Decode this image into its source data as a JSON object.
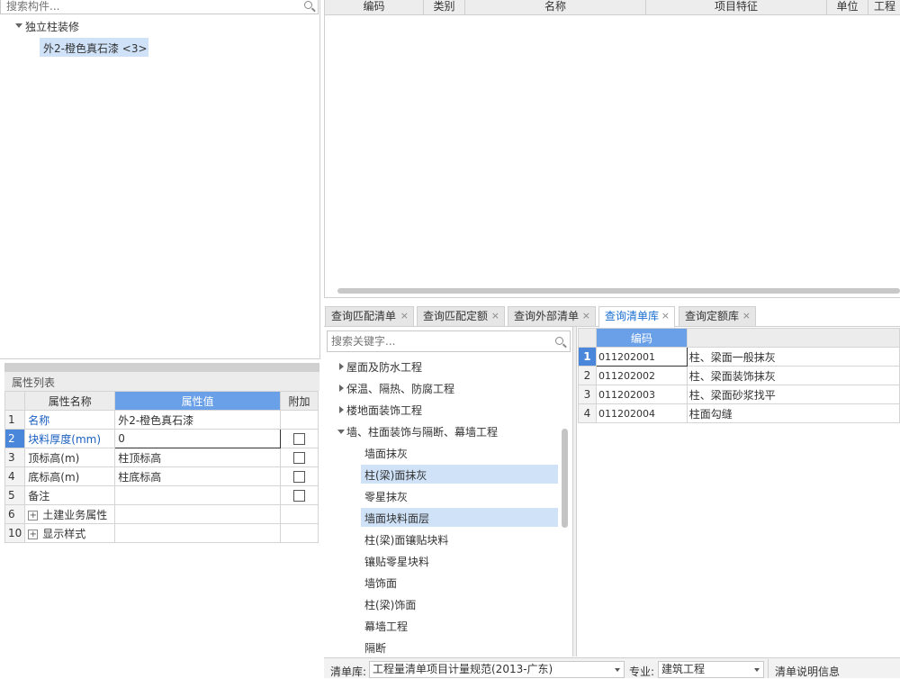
{
  "component_search": {
    "placeholder": "搜索构件..."
  },
  "component_tree": {
    "group_label": "独立柱装修",
    "selected_item": "外2-橙色真石漆 <3>"
  },
  "properties": {
    "title": "属性列表",
    "headers": {
      "num": "",
      "name": "属性名称",
      "value": "属性值",
      "extra": "附加"
    },
    "rows": [
      {
        "num": "1",
        "name": "名称",
        "value": "外2-橙色真石漆"
      },
      {
        "num": "2",
        "name": "块料厚度(mm)",
        "value": "0"
      },
      {
        "num": "3",
        "name": "顶标高(m)",
        "value": "柱顶标高"
      },
      {
        "num": "4",
        "name": "底标高(m)",
        "value": "柱底标高"
      },
      {
        "num": "5",
        "name": "备注",
        "value": ""
      },
      {
        "num": "6",
        "name": "土建业务属性",
        "value": ""
      },
      {
        "num": "10",
        "name": "显示样式",
        "value": ""
      }
    ]
  },
  "top_grid": {
    "columns": [
      "编码",
      "类别",
      "名称",
      "项目特征",
      "单位",
      "工程"
    ]
  },
  "tabs": [
    {
      "label": "查询匹配清单"
    },
    {
      "label": "查询匹配定额"
    },
    {
      "label": "查询外部清单"
    },
    {
      "label": "查询清单库"
    },
    {
      "label": "查询定额库"
    }
  ],
  "lib_search": {
    "placeholder": "搜索关键字..."
  },
  "lib_tree": {
    "collapsed": [
      "屋面及防水工程",
      "保温、隔热、防腐工程",
      "楼地面装饰工程"
    ],
    "expanded": "墙、柱面装饰与隔断、幕墙工程",
    "children": [
      "墙面抹灰",
      "柱(梁)面抹灰",
      "零星抹灰",
      "墙面块料面层",
      "柱(梁)面镶贴块料",
      "镶贴零星块料",
      "墙饰面",
      "柱(梁)饰面",
      "幕墙工程",
      "隔断"
    ]
  },
  "results": {
    "header_code": "编码",
    "rows": [
      {
        "num": "1",
        "code": "011202001",
        "name": "柱、梁面一般抹灰"
      },
      {
        "num": "2",
        "code": "011202002",
        "name": "柱、梁面装饰抹灰"
      },
      {
        "num": "3",
        "code": "011202003",
        "name": "柱、梁面砂浆找平"
      },
      {
        "num": "4",
        "code": "011202004",
        "name": "柱面勾缝"
      }
    ]
  },
  "bottom": {
    "list_label": "清单库:",
    "list_value": "工程量清单项目计量规范(2013-广东)",
    "major_label": "专业:",
    "major_value": "建筑工程",
    "info_label": "清单说明信息"
  }
}
